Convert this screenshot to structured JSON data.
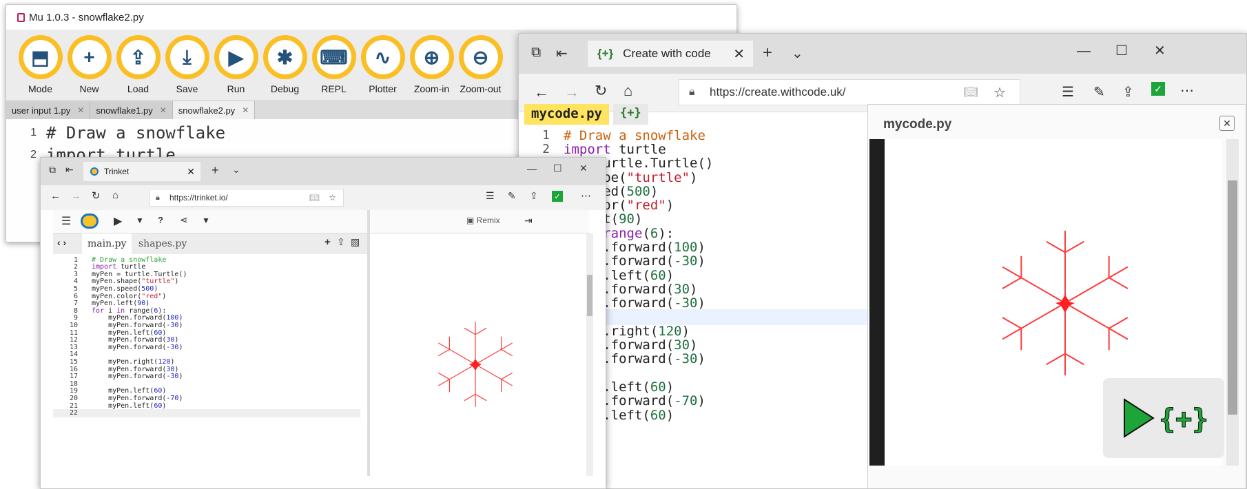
{
  "mu": {
    "title": "Mu 1.0.3 - snowflake2.py",
    "buttons": [
      {
        "label": "Mode",
        "icon": "mode-icon",
        "glyph": "⬒"
      },
      {
        "label": "New",
        "icon": "plus-icon",
        "glyph": "+"
      },
      {
        "label": "Load",
        "icon": "upload-icon",
        "glyph": "⇪"
      },
      {
        "label": "Save",
        "icon": "download-icon",
        "glyph": "⤓"
      },
      {
        "label": "Run",
        "icon": "play-icon",
        "glyph": "▶"
      },
      {
        "label": "Debug",
        "icon": "bug-icon",
        "glyph": "✱"
      },
      {
        "label": "REPL",
        "icon": "keyboard-icon",
        "glyph": "⌨"
      },
      {
        "label": "Plotter",
        "icon": "pulse-icon",
        "glyph": "∿"
      },
      {
        "label": "Zoom-in",
        "icon": "zoom-in-icon",
        "glyph": "⊕"
      },
      {
        "label": "Zoom-out",
        "icon": "zoom-out-icon",
        "glyph": "⊖"
      }
    ],
    "tabs": [
      "user input 1.py",
      "snowflake1.py",
      "snowflake2.py"
    ],
    "code": [
      {
        "num": "1",
        "text": "# Draw a snowflake"
      },
      {
        "num": "2",
        "text": "import turtle"
      }
    ]
  },
  "withcode": {
    "tab_title": "Create with code",
    "url": "https://create.withcode.uk/",
    "file_tab": "mycode.py",
    "file_tab2": "{+}",
    "panel_title": "mycode.py",
    "code": [
      {
        "num": "1",
        "html": "<span class='cm'># Draw a snowflake</span>"
      },
      {
        "num": "2",
        "html": "<span class='kw'>import</span> turtle"
      },
      {
        "num": "",
        "html": "n = turtle.Turtle()"
      },
      {
        "num": "",
        "html": "n.shape(<span class='str'>\"turtle\"</span>)"
      },
      {
        "num": "",
        "html": "n.speed(<span class='num'>500</span>)"
      },
      {
        "num": "",
        "html": "n.color(<span class='str'>\"red\"</span>)"
      },
      {
        "num": "",
        "html": "n.left(<span class='num'>90</span>)"
      },
      {
        "num": "",
        "html": "i <span class='kw'>in</span> <span class='bi'>range</span>(<span class='num'>6</span>):"
      },
      {
        "num": "",
        "html": "myPen.forward(<span class='num'>100</span>)"
      },
      {
        "num": "",
        "html": "myPen.forward(<span class='num'>-30</span>)"
      },
      {
        "num": "",
        "html": "myPen.left(<span class='num'>60</span>)"
      },
      {
        "num": "",
        "html": "myPen.forward(<span class='num'>30</span>)"
      },
      {
        "num": "",
        "html": "myPen.forward(<span class='num'>-30</span>)"
      },
      {
        "num": "",
        "html": ""
      },
      {
        "num": "",
        "html": "myPen.right(<span class='num'>120</span>)"
      },
      {
        "num": "",
        "html": "myPen.forward(<span class='num'>30</span>)"
      },
      {
        "num": "",
        "html": "myPen.forward(<span class='num'>-30</span>)"
      },
      {
        "num": "",
        "html": ""
      },
      {
        "num": "",
        "html": "myPen.left(<span class='num'>60</span>)"
      },
      {
        "num": "",
        "html": "myPen.forward(<span class='num'>-70</span>)"
      },
      {
        "num": "",
        "html": "myPen.left(<span class='num'>60</span>)"
      }
    ]
  },
  "trinket": {
    "tab_title": "Trinket",
    "url": "https://trinket.io/",
    "remix_label": "Remix",
    "file_tabs": [
      "main.py",
      "shapes.py"
    ],
    "code": [
      {
        "num": "1",
        "html": "<span class='tkcm'># Draw a snowflake</span>"
      },
      {
        "num": "2",
        "html": "<span class='tkkw'>import</span> turtle"
      },
      {
        "num": "3",
        "html": "myPen = turtle.Turtle()"
      },
      {
        "num": "4",
        "html": "myPen.shape(<span class='tkstr'>\"turtle\"</span>)"
      },
      {
        "num": "5",
        "html": "myPen.speed(<span class='tknum'>500</span>)"
      },
      {
        "num": "6",
        "html": "myPen.color(<span class='tkstr'>\"red\"</span>)"
      },
      {
        "num": "7",
        "html": "myPen.left(<span class='tknum'>90</span>)"
      },
      {
        "num": "8",
        "html": "<span class='tkkw'>for</span> i <span class='tkkw'>in</span> range(<span class='tknum'>6</span>):"
      },
      {
        "num": "9",
        "html": "    myPen.forward(<span class='tknum'>100</span>)"
      },
      {
        "num": "10",
        "html": "    myPen.forward(<span class='tknum'>-30</span>)"
      },
      {
        "num": "11",
        "html": "    myPen.left(<span class='tknum'>60</span>)"
      },
      {
        "num": "12",
        "html": "    myPen.forward(<span class='tknum'>30</span>)"
      },
      {
        "num": "13",
        "html": "    myPen.forward(<span class='tknum'>-30</span>)"
      },
      {
        "num": "14",
        "html": ""
      },
      {
        "num": "15",
        "html": "    myPen.right(<span class='tknum'>120</span>)"
      },
      {
        "num": "16",
        "html": "    myPen.forward(<span class='tknum'>30</span>)"
      },
      {
        "num": "17",
        "html": "    myPen.forward(<span class='tknum'>-30</span>)"
      },
      {
        "num": "18",
        "html": ""
      },
      {
        "num": "19",
        "html": "    myPen.left(<span class='tknum'>60</span>)"
      },
      {
        "num": "20",
        "html": "    myPen.forward(<span class='tknum'>-70</span>)"
      },
      {
        "num": "21",
        "html": "    myPen.left(<span class='tknum'>60</span>)"
      },
      {
        "num": "22",
        "html": "    "
      }
    ]
  },
  "colors": {
    "mu_button": "#fbbf26",
    "mu_icon": "#24527a",
    "snowflake": "#ff3b3b",
    "file_tab_highlight": "#ffe460"
  }
}
